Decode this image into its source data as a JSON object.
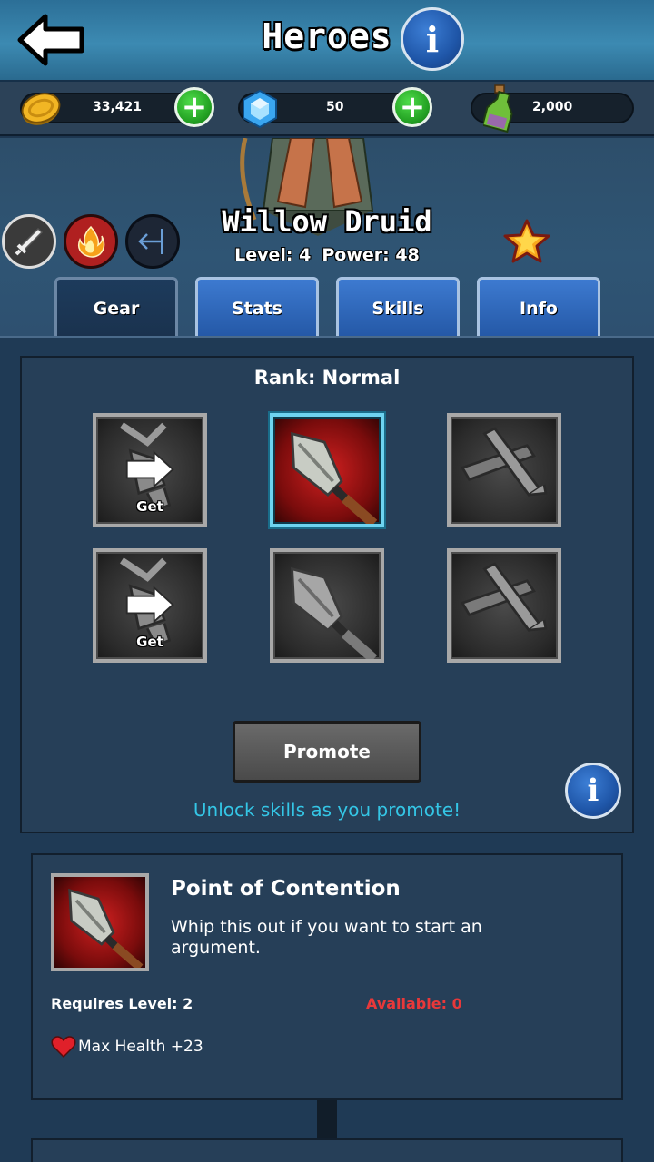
{
  "header": {
    "title": "Heroes",
    "info_label": "i"
  },
  "currency": {
    "gold": "33,421",
    "gems": "50",
    "potions": "2,000"
  },
  "hero": {
    "name": "Willow Druid",
    "level_text": "Level: 4",
    "power_text": "Power: 48",
    "class_icons": [
      "sword-icon",
      "fire-icon",
      "arrow-icon"
    ],
    "star_icon": "star-icon"
  },
  "tabs": [
    {
      "label": "Gear",
      "active": true
    },
    {
      "label": "Stats",
      "active": false
    },
    {
      "label": "Skills",
      "active": false
    },
    {
      "label": "Info",
      "active": false
    }
  ],
  "gear": {
    "rank_text": "Rank: Normal",
    "get_label": "Get",
    "slots": [
      {
        "item": "gauntlet",
        "state": "get"
      },
      {
        "item": "spear-head",
        "state": "selected"
      },
      {
        "item": "crossed-bars",
        "state": "locked"
      },
      {
        "item": "gauntlet",
        "state": "get"
      },
      {
        "item": "spear-head",
        "state": "locked"
      },
      {
        "item": "crossed-bars",
        "state": "locked"
      }
    ],
    "promote_label": "Promote",
    "unlock_text": "Unlock skills as you promote!"
  },
  "item_detail": {
    "name": "Point of Contention",
    "description": "Whip this out if you want to start an argument.",
    "requires_level": "Requires Level: 2",
    "available": "Available: 0",
    "stat": "Max Health +23"
  },
  "colors": {
    "accent_blue": "#2458a6",
    "unlock_text": "#34c6e6",
    "available_red": "#e8383a"
  }
}
